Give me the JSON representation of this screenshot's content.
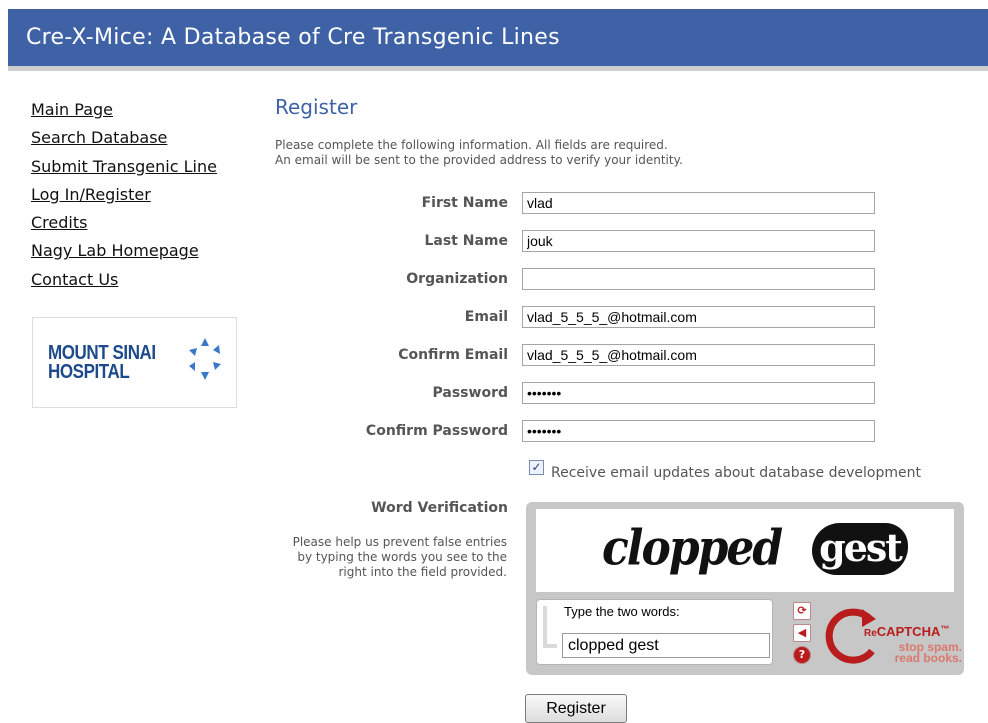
{
  "header": {
    "title": "Cre-X-Mice: A Database of Cre Transgenic Lines"
  },
  "sidebar": {
    "items": [
      {
        "label": "Main Page"
      },
      {
        "label": "Search Database"
      },
      {
        "label": "Submit Transgenic Line"
      },
      {
        "label": "Log In/Register"
      },
      {
        "label": "Credits"
      },
      {
        "label": "Nagy Lab Homepage"
      },
      {
        "label": "Contact Us"
      }
    ],
    "logo": {
      "line1": "MOUNT SINAI",
      "line2": "HOSPITAL"
    }
  },
  "main": {
    "heading": "Register",
    "intro_line1": "Please complete the following information. All fields are required.",
    "intro_line2": "An email will be sent to the provided address to verify your identity.",
    "fields": {
      "first_name": {
        "label": "First Name",
        "value": "vlad"
      },
      "last_name": {
        "label": "Last Name",
        "value": "jouk"
      },
      "organization": {
        "label": "Organization",
        "value": ""
      },
      "email": {
        "label": "Email",
        "value": "vlad_5_5_5_@hotmail.com"
      },
      "confirm_email": {
        "label": "Confirm Email",
        "value": "vlad_5_5_5_@hotmail.com"
      },
      "password": {
        "label": "Password",
        "value": "•••••••"
      },
      "confirm_password": {
        "label": "Confirm Password",
        "value": "•••••••"
      }
    },
    "updates_checkbox": {
      "label": "Receive email updates about database development",
      "checked": true
    },
    "word_verification": {
      "title": "Word Verification",
      "help": "Please help us prevent false entries by typing the words you see to the right into the field provided."
    },
    "captcha": {
      "word1": "clopped",
      "word2": "gest",
      "prompt": "Type the two words:",
      "response": "clopped gest",
      "brand_prefix": "Re",
      "brand": "CAPTCHA",
      "tm": "™",
      "tagline1": "stop spam.",
      "tagline2": "read books.",
      "icons": [
        "refresh-icon",
        "audio-icon",
        "help-icon"
      ],
      "accent_color": "#b81c1c"
    },
    "register_label": "Register"
  }
}
